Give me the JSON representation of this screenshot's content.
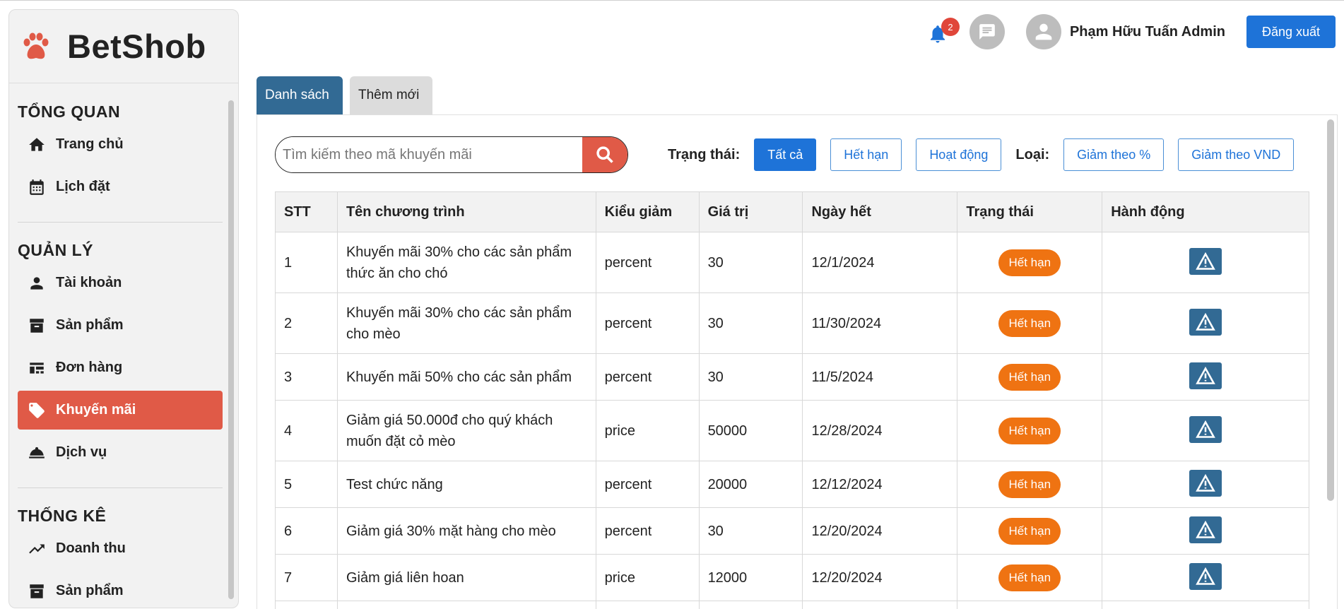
{
  "brand": {
    "name": "BetShob",
    "icon": "paw-icon",
    "color": "#e05a47"
  },
  "sidebar": {
    "sections": [
      {
        "title": "TỔNG QUAN",
        "items": [
          {
            "label": "Trang chủ",
            "icon": "home-icon"
          },
          {
            "label": "Lịch đặt",
            "icon": "calendar-icon"
          }
        ]
      },
      {
        "title": "QUẢN LÝ",
        "items": [
          {
            "label": "Tài khoản",
            "icon": "person-icon"
          },
          {
            "label": "Sản phẩm",
            "icon": "archive-icon"
          },
          {
            "label": "Đơn hàng",
            "icon": "dashboard-icon"
          },
          {
            "label": "Khuyến mãi",
            "icon": "tag-icon",
            "active": true
          },
          {
            "label": "Dịch vụ",
            "icon": "service-bell-icon"
          }
        ]
      },
      {
        "title": "THỐNG KÊ",
        "items": [
          {
            "label": "Doanh thu",
            "icon": "trending-up-icon"
          },
          {
            "label": "Sản phẩm",
            "icon": "archive-icon"
          }
        ]
      }
    ]
  },
  "header": {
    "notification_count": "2",
    "username": "Phạm Hữu Tuấn Admin",
    "logout_label": "Đăng xuất"
  },
  "tabs": [
    {
      "label": "Danh sách",
      "active": true
    },
    {
      "label": "Thêm mới",
      "active": false
    }
  ],
  "filters": {
    "search_placeholder": "Tìm kiếm theo mã khuyến mãi",
    "status_label": "Trạng thái:",
    "status_options": [
      "Tất cả",
      "Hết hạn",
      "Hoạt động"
    ],
    "status_selected": "Tất cả",
    "type_label": "Loại:",
    "type_options": [
      "Giảm theo %",
      "Giảm theo VND"
    ]
  },
  "table": {
    "columns": [
      "STT",
      "Tên chương trình",
      "Kiểu giảm",
      "Giá trị",
      "Ngày hết",
      "Trạng thái",
      "Hành động"
    ],
    "rows": [
      {
        "stt": "1",
        "name_l1": "Khuyến mãi 30% cho các sản phẩm",
        "name_l2": "thức ăn cho chó",
        "type": "percent",
        "value": "30",
        "end": "12/1/2024",
        "status": "Hết hạn"
      },
      {
        "stt": "2",
        "name_l1": "Khuyến mãi 30% cho các sản phẩm",
        "name_l2": "cho mèo",
        "type": "percent",
        "value": "30",
        "end": "11/30/2024",
        "status": "Hết hạn"
      },
      {
        "stt": "3",
        "name_l1": "Khuyến mãi 50% cho các sản phẩm",
        "name_l2": "",
        "type": "percent",
        "value": "30",
        "end": "11/5/2024",
        "status": "Hết hạn"
      },
      {
        "stt": "4",
        "name_l1": "Giảm giá 50.000đ cho quý khách",
        "name_l2": "muốn đặt cỏ mèo",
        "type": "price",
        "value": "50000",
        "end": "12/28/2024",
        "status": "Hết hạn"
      },
      {
        "stt": "5",
        "name_l1": "Test chức năng",
        "name_l2": "",
        "type": "percent",
        "value": "20000",
        "end": "12/12/2024",
        "status": "Hết hạn"
      },
      {
        "stt": "6",
        "name_l1": "Giảm giá 30% mặt hàng cho mèo",
        "name_l2": "",
        "type": "percent",
        "value": "30",
        "end": "12/20/2024",
        "status": "Hết hạn"
      },
      {
        "stt": "7",
        "name_l1": "Giảm giá liên hoan",
        "name_l2": "",
        "type": "price",
        "value": "12000",
        "end": "12/20/2024",
        "status": "Hết hạn"
      }
    ],
    "action_icon": "warning-triangle-icon"
  },
  "colors": {
    "primary": "#1e73d8",
    "accent": "#e05a47",
    "tab_active": "#326a94",
    "status_expired": "#ef7312"
  }
}
